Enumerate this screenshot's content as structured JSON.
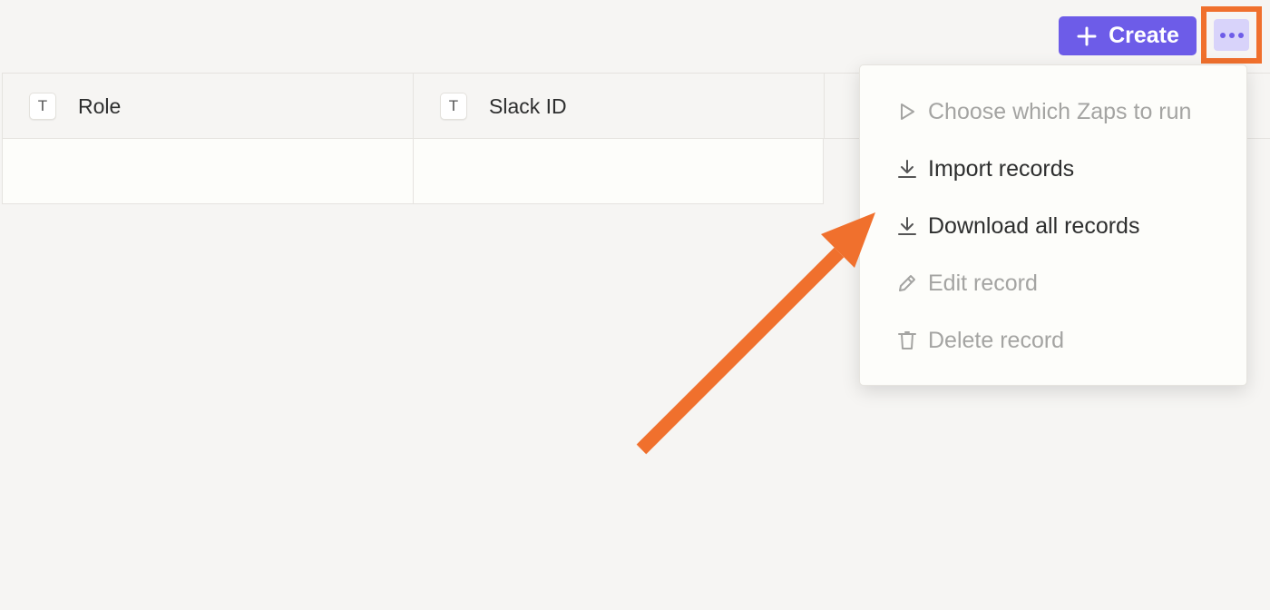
{
  "toolbar": {
    "create_label": "Create"
  },
  "table": {
    "columns": [
      {
        "type_glyph": "T",
        "label": "Role"
      },
      {
        "type_glyph": "T",
        "label": "Slack ID"
      }
    ],
    "rows": [
      [
        "",
        ""
      ]
    ]
  },
  "menu": {
    "items": [
      {
        "icon": "play-icon",
        "label": "Choose which Zaps to run",
        "enabled": false
      },
      {
        "icon": "download-icon",
        "label": "Import records",
        "enabled": true
      },
      {
        "icon": "download-icon",
        "label": "Download all records",
        "enabled": true
      },
      {
        "icon": "pencil-icon",
        "label": "Edit record",
        "enabled": false
      },
      {
        "icon": "trash-icon",
        "label": "Delete record",
        "enabled": false
      }
    ]
  },
  "colors": {
    "accent": "#6d5ce8",
    "more_button_bg": "#d8d3fa",
    "highlight": "#f0702d",
    "disabled_text": "#a4a4a2"
  }
}
